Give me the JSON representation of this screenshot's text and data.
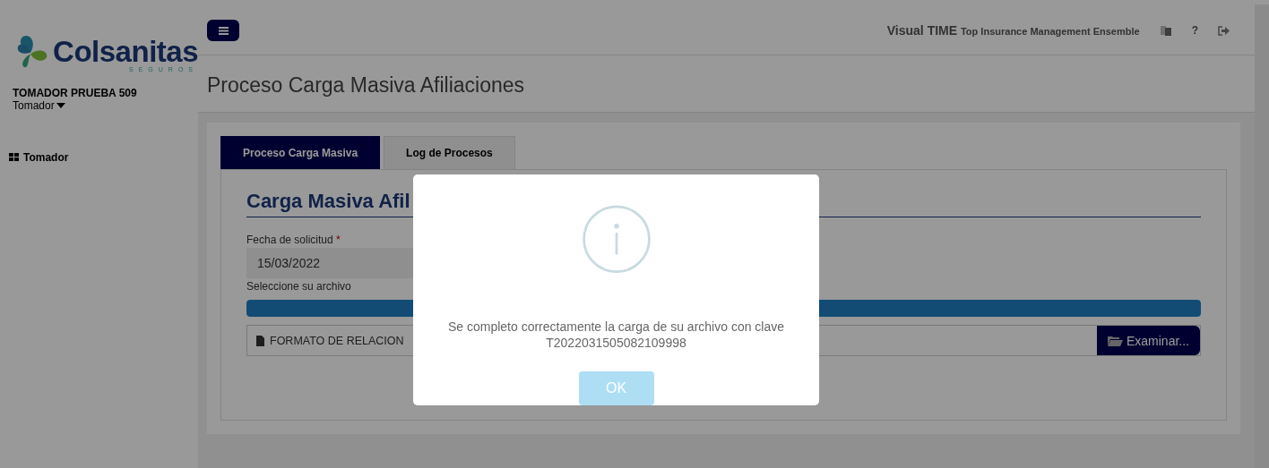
{
  "sidebar": {
    "logo": {
      "name": "Colsanitas",
      "tagline": "SEGUROS"
    },
    "user": {
      "name": "TOMADOR PRUEBA 509",
      "role": "Tomador"
    },
    "items": [
      {
        "label": "Tomador",
        "selected": false
      }
    ]
  },
  "header": {
    "brand": "Visual TIME",
    "subtitle": "Top Insurance Management Ensemble",
    "help": "?"
  },
  "page_title": "Proceso Carga Masiva Afiliaciones",
  "tabs": [
    {
      "label": "Proceso Carga Masiva",
      "selected": true
    },
    {
      "label": "Log de Procesos",
      "selected": false
    }
  ],
  "form": {
    "heading": "Carga Masiva Afil",
    "date_label": "Fecha de solicitud",
    "required_mark": "*",
    "date_value": "15/03/2022",
    "file_label": "Seleccione su archivo",
    "progress": {
      "level": 1
    },
    "file_name": "FORMATO DE RELACION",
    "browse_button": "Examinar..."
  },
  "dialog": {
    "message": "Se completo correctamente la carga de su archivo con clave",
    "code": "T2022031505082109998",
    "button": "OK"
  }
}
